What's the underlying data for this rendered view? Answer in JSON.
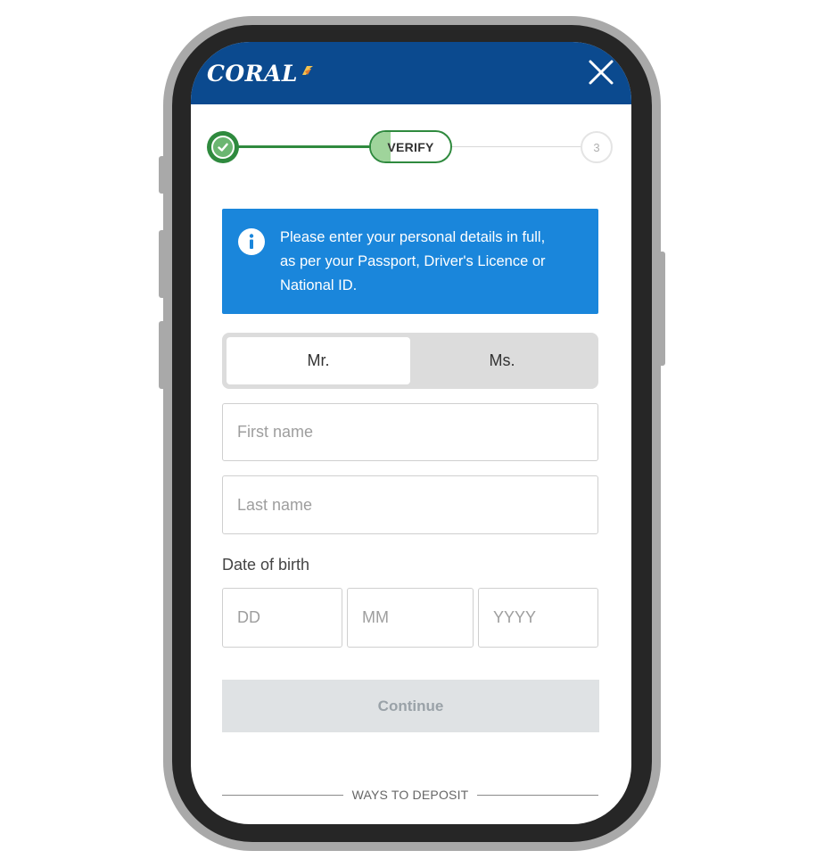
{
  "header": {
    "logo_text": "CORAL",
    "brand_color": "#0b4a8f",
    "close_icon": "close-icon"
  },
  "stepper": {
    "step1": {
      "status": "complete",
      "icon": "check-icon"
    },
    "step2": {
      "label": "VERIFY",
      "status": "active",
      "progress": 0.25
    },
    "step3": {
      "label": "3",
      "status": "pending"
    },
    "accent_color": "#2f8a3e"
  },
  "info": {
    "icon": "info-icon",
    "message_line1": "Please enter your personal details in full,",
    "message_line2": "as per your Passport, Driver's Licence or",
    "message_line3": "National ID.",
    "color": "#1a86db"
  },
  "title_toggle": {
    "options": [
      "Mr.",
      "Ms."
    ],
    "selected": "Mr."
  },
  "form": {
    "first_name_placeholder": "First name",
    "first_name_value": "",
    "last_name_placeholder": "Last name",
    "last_name_value": "",
    "dob_label": "Date of birth",
    "dd_placeholder": "DD",
    "mm_placeholder": "MM",
    "yyyy_placeholder": "YYYY"
  },
  "continue_button": {
    "label": "Continue",
    "enabled": false
  },
  "footer": {
    "ways_to_deposit": "WAYS TO DEPOSIT"
  }
}
